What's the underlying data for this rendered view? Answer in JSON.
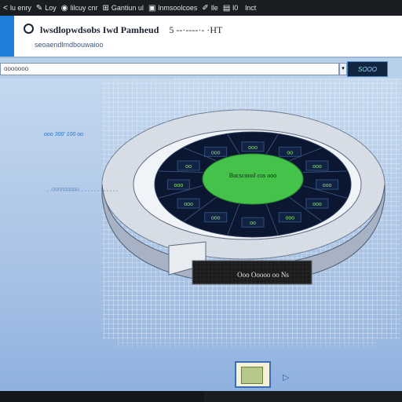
{
  "toolbar": {
    "items": [
      {
        "icon": "back-icon",
        "glyph": "<",
        "label": "lu enry"
      },
      {
        "icon": "edit-icon",
        "glyph": "✎",
        "label": "Loy"
      },
      {
        "icon": "circle-icon",
        "glyph": "◉",
        "label": "lilcuy cnr"
      },
      {
        "icon": "grid-icon",
        "glyph": "⊞",
        "label": "Gantiun ul"
      },
      {
        "icon": "doc-icon",
        "glyph": "▣",
        "label": "lnmsoolcoes"
      },
      {
        "icon": "pen-icon",
        "glyph": "✐",
        "label": "lle"
      },
      {
        "icon": "box-icon",
        "glyph": "▤",
        "label": "l0"
      },
      {
        "icon": "text-icon",
        "glyph": "",
        "label": "lnct"
      }
    ]
  },
  "header": {
    "title": "lwsdlopwdsobs Iwd Pamheud",
    "title_suffix": "5 --·----·- ·HT",
    "subtitle": "seoaendlmdbouwaioo"
  },
  "address": {
    "value": "ooooooo",
    "button_label": "SOOO"
  },
  "canvas": {
    "side_label_top": "ooo 300' 100 oo",
    "side_label_bottom": "oonnoooou",
    "center_label": "Bucscoool cos ooo",
    "base_label": "Ooo Ooooo oo Ns",
    "ring_labels": [
      "ooo",
      "ooo",
      "ooo",
      "oo",
      "ooo",
      "ooo",
      "ooo",
      "oo",
      "ooo",
      "ooo",
      "oo",
      "ooo"
    ]
  },
  "colors": {
    "accent": "#1e7fd9",
    "hub": "#44c24a",
    "ring": "#0b1730",
    "grid": "#e6eef8"
  }
}
